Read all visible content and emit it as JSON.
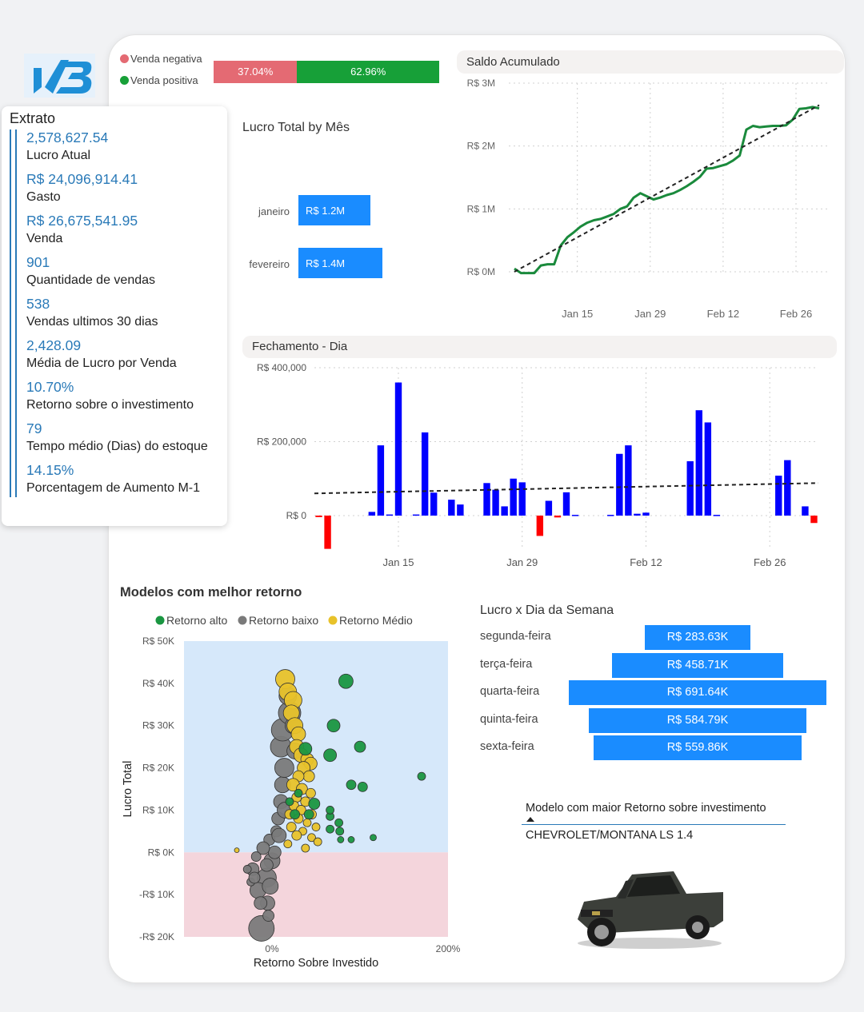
{
  "colors": {
    "accent_blue": "#2a7ab8",
    "bar_blue": "#1a8cff",
    "negative": "#e46a73",
    "positive": "#17a038",
    "line_green": "#1a8a3c",
    "daily_positive": "#0000ff",
    "daily_negative": "#ff0000",
    "retorno_alto": "#1a9641",
    "retorno_baixo": "#7a7a7a",
    "retorno_medio": "#e8c22a"
  },
  "extrato": {
    "title": "Extrato",
    "kpis": [
      {
        "value": "2,578,627.54",
        "label": "Lucro Atual"
      },
      {
        "value": "R$ 24,096,914.41",
        "label": "Gasto"
      },
      {
        "value": "R$ 26,675,541.95",
        "label": "Venda"
      },
      {
        "value": "901",
        "label": "Quantidade de vendas"
      },
      {
        "value": "538",
        "label": "Vendas ultimos 30 dias"
      },
      {
        "value": "2,428.09",
        "label": "Média de Lucro por Venda"
      },
      {
        "value": "10.70%",
        "label": "Retorno sobre o investimento"
      },
      {
        "value": "79",
        "label": "Tempo médio (Dias) do estoque"
      },
      {
        "value": "14.15%",
        "label": "Porcentagem de Aumento M-1"
      }
    ]
  },
  "sales_split": {
    "negative_label": "Venda negativa",
    "positive_label": "Venda positiva",
    "negative_pct": 37.04,
    "positive_pct": 62.96,
    "negative_text": "37.04%",
    "positive_text": "62.96%"
  },
  "best_model": {
    "label": "Modelo com maior Retorno sobre investimento",
    "value": "CHEVROLET/MONTANA LS 1.4"
  },
  "chart_data": [
    {
      "id": "lucro_mes",
      "type": "bar",
      "title": "Lucro Total by Mês",
      "categories": [
        "janeiro",
        "fevereiro"
      ],
      "values": [
        1.2,
        1.4
      ],
      "value_labels": [
        "R$ 1.2M",
        "R$ 1.4M"
      ],
      "orientation": "horizontal"
    },
    {
      "id": "saldo",
      "type": "line",
      "title": "Saldo Acumulado",
      "y_ticks": [
        "R$ 3M",
        "R$ 2M",
        "R$ 1M",
        "R$ 0M"
      ],
      "x_ticks": [
        "Jan 15",
        "Jan 29",
        "Feb 12",
        "Feb 26"
      ],
      "ylim": [
        0,
        3
      ],
      "y_unit": "R$ M",
      "series": [
        {
          "values": [
            [
              0,
              0.05
            ],
            [
              1,
              -0.02
            ],
            [
              2,
              -0.02
            ],
            [
              3,
              -0.02
            ],
            [
              4,
              0.1
            ],
            [
              5,
              0.12
            ],
            [
              6,
              0.12
            ],
            [
              7,
              0.42
            ],
            [
              8,
              0.55
            ],
            [
              9,
              0.63
            ],
            [
              10,
              0.72
            ],
            [
              11,
              0.78
            ],
            [
              12,
              0.82
            ],
            [
              13,
              0.84
            ],
            [
              14,
              0.88
            ],
            [
              15,
              0.92
            ],
            [
              16,
              1.0
            ],
            [
              17,
              1.04
            ],
            [
              18,
              1.18
            ],
            [
              19,
              1.25
            ],
            [
              20,
              1.2
            ],
            [
              21,
              1.15
            ],
            [
              22,
              1.18
            ],
            [
              23,
              1.22
            ],
            [
              24,
              1.25
            ],
            [
              25,
              1.3
            ],
            [
              26,
              1.36
            ],
            [
              27,
              1.43
            ],
            [
              28,
              1.51
            ],
            [
              29,
              1.64
            ],
            [
              30,
              1.65
            ],
            [
              31,
              1.68
            ],
            [
              32,
              1.71
            ],
            [
              33,
              1.77
            ],
            [
              34,
              1.85
            ],
            [
              35,
              2.26
            ],
            [
              36,
              2.32
            ],
            [
              37,
              2.3
            ],
            [
              38,
              2.31
            ],
            [
              39,
              2.32
            ],
            [
              40,
              2.32
            ],
            [
              41,
              2.33
            ],
            [
              42,
              2.42
            ],
            [
              43,
              2.59
            ],
            [
              44,
              2.6
            ],
            [
              45,
              2.62
            ],
            [
              46,
              2.6
            ]
          ]
        }
      ],
      "trend": [
        [
          0,
          0.0
        ],
        [
          46,
          2.65
        ]
      ],
      "x_start": "Jan 8",
      "x_end": "Feb 28"
    },
    {
      "id": "fechamento",
      "type": "bar",
      "title": "Fechamento - Dia",
      "y_ticks": [
        "R$ 400,000",
        "R$ 200,000",
        "R$ 0"
      ],
      "x_ticks": [
        "Jan 15",
        "Jan 29",
        "Feb 12",
        "Feb 26"
      ],
      "ylim": [
        -90000,
        400000
      ],
      "values": [
        -4000,
        -90000,
        0,
        0,
        0,
        0,
        10000,
        190000,
        3000,
        360000,
        0,
        3000,
        225000,
        62000,
        0,
        43000,
        30000,
        0,
        0,
        88000,
        70000,
        25000,
        100000,
        90000,
        0,
        -55000,
        40000,
        -5000,
        63000,
        2000,
        0,
        0,
        0,
        2000,
        167000,
        190000,
        5000,
        8000,
        0,
        0,
        0,
        0,
        147000,
        285000,
        252000,
        2000,
        0,
        0,
        0,
        0,
        0,
        0,
        108000,
        150000,
        0,
        25000,
        -20000
      ],
      "trend": [
        [
          0,
          60000
        ],
        [
          57,
          88000
        ]
      ]
    },
    {
      "id": "modelos",
      "type": "scatter",
      "title": "Modelos com melhor retorno",
      "xlabel": "Retorno Sobre Investido",
      "ylabel": "Lucro Total",
      "x_ticks": [
        "0%",
        "200%"
      ],
      "y_ticks": [
        "R$ 50K",
        "R$ 40K",
        "R$ 30K",
        "R$ 20K",
        "R$ 10K",
        "R$ 0K",
        "-R$ 10K",
        "-R$ 20K"
      ],
      "xlim": [
        -10,
        200
      ],
      "ylim": [
        -20,
        50
      ],
      "y_unit": "R$ K",
      "x_unit": "%",
      "legend": [
        "Retorno alto",
        "Retorno baixo",
        "Retorno Médio"
      ],
      "series": [
        {
          "name": "Retorno alto",
          "points": [
            [
              84,
              40.5,
              9
            ],
            [
              70,
              30,
              8
            ],
            [
              100,
              25,
              7
            ],
            [
              38,
              24.5,
              8
            ],
            [
              66,
              23,
              8
            ],
            [
              90,
              16,
              6
            ],
            [
              103,
              15.5,
              6
            ],
            [
              170,
              18,
              5
            ],
            [
              48,
              11.5,
              7
            ],
            [
              42,
              9,
              6
            ],
            [
              66,
              8.5,
              5
            ],
            [
              66,
              10,
              5
            ],
            [
              76,
              7,
              5
            ],
            [
              66,
              5.5,
              5
            ],
            [
              77,
              5,
              5
            ],
            [
              78,
              3,
              4
            ],
            [
              90,
              3,
              4
            ],
            [
              115,
              3.5,
              4
            ],
            [
              26,
              9,
              6
            ],
            [
              20,
              12,
              5
            ],
            [
              30,
              14,
              5
            ]
          ]
        },
        {
          "name": "Retorno baixo",
          "points": [
            [
              -12,
              -18,
              16
            ],
            [
              -6,
              -6,
              12
            ],
            [
              -16,
              -9,
              10
            ],
            [
              -22,
              -4,
              8
            ],
            [
              -5,
              -12,
              9
            ],
            [
              0,
              -2,
              10
            ],
            [
              3,
              0,
              8
            ],
            [
              -3,
              3,
              7
            ],
            [
              -10,
              1,
              8
            ],
            [
              -18,
              -1,
              6
            ],
            [
              -24,
              -7,
              5
            ],
            [
              -4,
              -15,
              7
            ],
            [
              5,
              5,
              7
            ],
            [
              7,
              8,
              8
            ],
            [
              10,
              12,
              9
            ],
            [
              12,
              16,
              10
            ],
            [
              14,
              20,
              12
            ],
            [
              10,
              25,
              13
            ],
            [
              12,
              29,
              14
            ],
            [
              20,
              33,
              14
            ],
            [
              18,
              37,
              11
            ],
            [
              24,
              30,
              10
            ],
            [
              26,
              24,
              10
            ],
            [
              15,
              10,
              10
            ],
            [
              8,
              4,
              9
            ],
            [
              -6,
              -3,
              8
            ],
            [
              -2,
              -8,
              10
            ],
            [
              -13,
              -12,
              8
            ],
            [
              -20,
              -6,
              7
            ],
            [
              -28,
              -4,
              5
            ]
          ]
        },
        {
          "name": "Retorno Médio",
          "points": [
            [
              15,
              41,
              12
            ],
            [
              18,
              38,
              11
            ],
            [
              24,
              36,
              11
            ],
            [
              22,
              33,
              10
            ],
            [
              26,
              30,
              10
            ],
            [
              30,
              28,
              9
            ],
            [
              28,
              25,
              9
            ],
            [
              33,
              23,
              9
            ],
            [
              40,
              22,
              8
            ],
            [
              44,
              21,
              8
            ],
            [
              36,
              20,
              8
            ],
            [
              42,
              18,
              7
            ],
            [
              30,
              18,
              7
            ],
            [
              24,
              16,
              8
            ],
            [
              34,
              15,
              7
            ],
            [
              44,
              14,
              6
            ],
            [
              28,
              13,
              6
            ],
            [
              38,
              12,
              6
            ],
            [
              25,
              11,
              6
            ],
            [
              33,
              10,
              6
            ],
            [
              45,
              9,
              6
            ],
            [
              20,
              9,
              6
            ],
            [
              30,
              8,
              6
            ],
            [
              40,
              7,
              5
            ],
            [
              50,
              6,
              5
            ],
            [
              22,
              6,
              6
            ],
            [
              35,
              5,
              5
            ],
            [
              28,
              4,
              6
            ],
            [
              45,
              3.5,
              5
            ],
            [
              52,
              2.5,
              5
            ],
            [
              18,
              2,
              5
            ],
            [
              38,
              1,
              5
            ],
            [
              -40,
              0.5,
              3
            ]
          ]
        }
      ]
    },
    {
      "id": "lucro_dia_semana",
      "type": "bar",
      "title": "Lucro x Dia da Semana",
      "categories": [
        "segunda-feira",
        "terça-feira",
        "quarta-feira",
        "quinta-feira",
        "sexta-feira"
      ],
      "values": [
        283.63,
        458.71,
        691.64,
        584.79,
        559.86
      ],
      "value_labels": [
        "R$ 283.63K",
        "R$ 458.71K",
        "R$ 691.64K",
        "R$ 584.79K",
        "R$ 559.86K"
      ],
      "orientation": "horizontal-centered",
      "unit": "R$ K"
    }
  ]
}
